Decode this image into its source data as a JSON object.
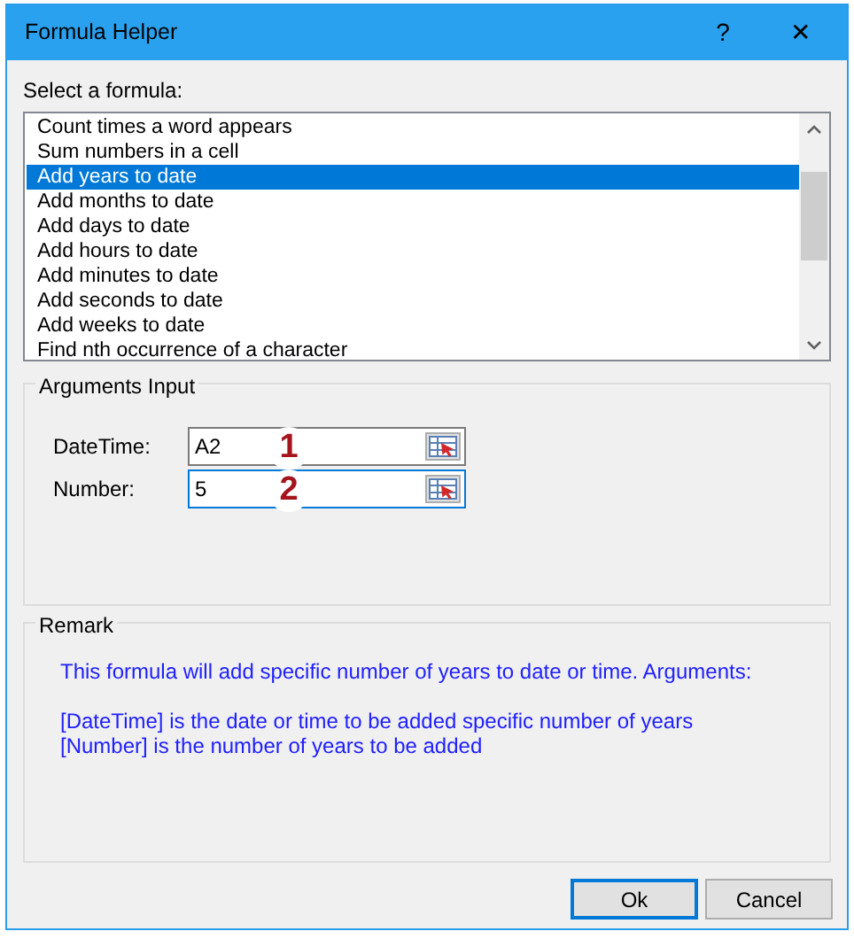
{
  "window": {
    "title": "Formula Helper",
    "help": "?",
    "close": "✕"
  },
  "formula_list": {
    "label": "Select a formula:",
    "items": [
      {
        "text": "Count times a word appears",
        "selected": false
      },
      {
        "text": "Sum numbers in a cell",
        "selected": false
      },
      {
        "text": "Add years to date",
        "selected": true
      },
      {
        "text": "Add months to date",
        "selected": false
      },
      {
        "text": "Add days to date",
        "selected": false
      },
      {
        "text": "Add hours to date",
        "selected": false
      },
      {
        "text": "Add minutes to date",
        "selected": false
      },
      {
        "text": "Add seconds to date",
        "selected": false
      },
      {
        "text": "Add weeks to date",
        "selected": false
      },
      {
        "text": "Find nth occurrence of a character",
        "selected": false
      }
    ]
  },
  "arguments": {
    "title": "Arguments Input",
    "fields": [
      {
        "label": "DateTime:",
        "value": "A2",
        "marker": "1",
        "focused": false
      },
      {
        "label": "Number:",
        "value": "5",
        "marker": "2",
        "focused": true
      }
    ]
  },
  "remark": {
    "title": "Remark",
    "intro": "This formula will add specific number of years to date or time. Arguments:",
    "details": [
      "[DateTime] is the date or time to be added specific number of years",
      "[Number] is the number of years to be added"
    ]
  },
  "buttons": [
    {
      "label": "Ok",
      "default": true
    },
    {
      "label": "Cancel",
      "default": false
    }
  ]
}
